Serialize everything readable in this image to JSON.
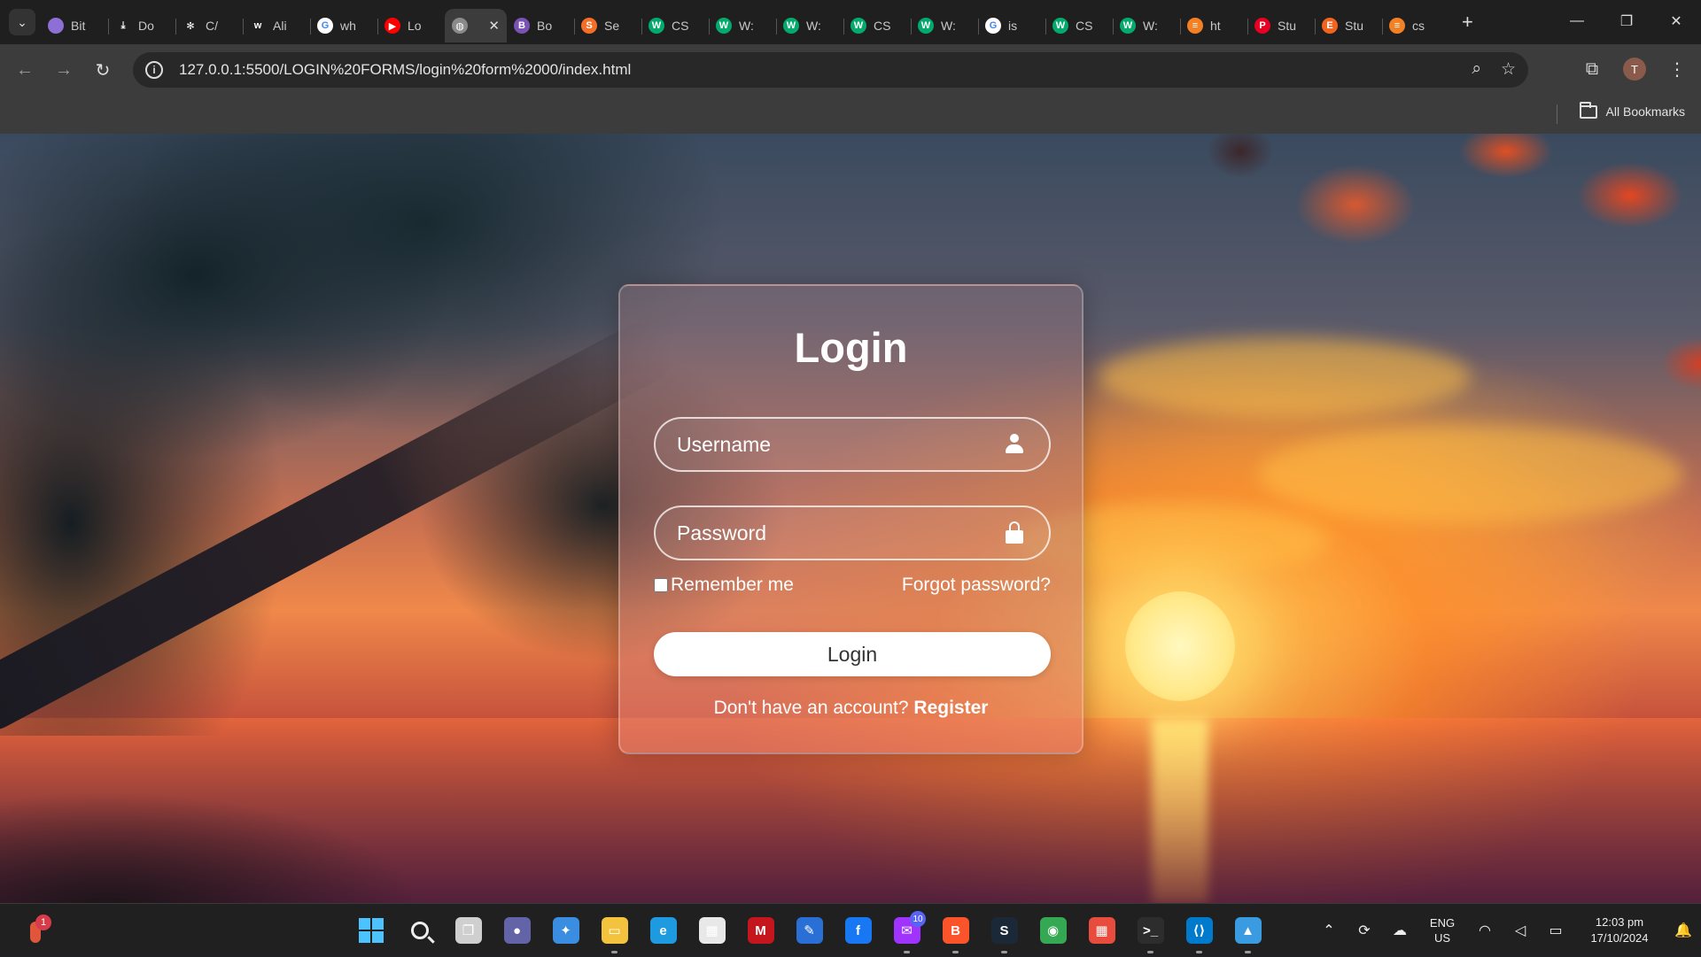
{
  "browser": {
    "url": "127.0.0.1:5500/LOGIN%20FORMS/login%20form%2000/index.html",
    "bookmarks_label": "All Bookmarks",
    "profile_initial": "T",
    "tabs": [
      {
        "title": "Bit",
        "icon": "globe-icon",
        "color": "#8e6fd6",
        "glyph": ""
      },
      {
        "title": "Do",
        "icon": "download-icon",
        "color": "#1f1f1f",
        "glyph": "⤓"
      },
      {
        "title": "C/",
        "icon": "openai-icon",
        "color": "#1f1f1f",
        "glyph": "✻"
      },
      {
        "title": "Ali",
        "icon": "w3-icon",
        "color": "#1f1f1f",
        "glyph": "w"
      },
      {
        "title": "wh",
        "icon": "google-icon",
        "color": "#ffffff",
        "glyph": "G"
      },
      {
        "title": "Lo",
        "icon": "youtube-icon",
        "color": "#ff0000",
        "glyph": "▶"
      },
      {
        "title": "",
        "icon": "globe-icon",
        "color": "#8a8a8a",
        "glyph": "◍"
      },
      {
        "title": "Bo",
        "icon": "bootstrap-icon",
        "color": "#7952b3",
        "glyph": "B"
      },
      {
        "title": "Se",
        "icon": "semrush-icon",
        "color": "#f56e28",
        "glyph": "S"
      },
      {
        "title": "CS",
        "icon": "w3schools-icon",
        "color": "#04aa6d",
        "glyph": "W"
      },
      {
        "title": "W:",
        "icon": "w3schools-icon",
        "color": "#04aa6d",
        "glyph": "W"
      },
      {
        "title": "W:",
        "icon": "w3schools-icon",
        "color": "#04aa6d",
        "glyph": "W"
      },
      {
        "title": "CS",
        "icon": "w3schools-icon",
        "color": "#04aa6d",
        "glyph": "W"
      },
      {
        "title": "W:",
        "icon": "w3schools-icon",
        "color": "#04aa6d",
        "glyph": "W"
      },
      {
        "title": "is",
        "icon": "google-icon",
        "color": "#ffffff",
        "glyph": "G"
      },
      {
        "title": "CS",
        "icon": "w3schools-icon",
        "color": "#04aa6d",
        "glyph": "W"
      },
      {
        "title": "W:",
        "icon": "w3schools-icon",
        "color": "#04aa6d",
        "glyph": "W"
      },
      {
        "title": "ht",
        "icon": "stackoverflow-icon",
        "color": "#f48024",
        "glyph": "≡"
      },
      {
        "title": "Stu",
        "icon": "pinterest-icon",
        "color": "#e60023",
        "glyph": "P"
      },
      {
        "title": "Stu",
        "icon": "etsy-icon",
        "color": "#f1641e",
        "glyph": "E"
      },
      {
        "title": "cs",
        "icon": "stackoverflow-icon",
        "color": "#f48024",
        "glyph": "≡"
      }
    ]
  },
  "login": {
    "title": "Login",
    "username_placeholder": "Username",
    "password_placeholder": "Password",
    "remember_label": "Remember me",
    "forgot_label": "Forgot password?",
    "button_label": "Login",
    "register_prompt": "Don't have an account?",
    "register_label": "Register"
  },
  "taskbar": {
    "widget_badge": "1",
    "messenger_badge": "10",
    "lang_line1": "ENG",
    "lang_line2": "US",
    "time": "12:03 pm",
    "date": "17/10/2024",
    "apps": [
      {
        "name": "start-button",
        "icon": "windows-icon",
        "color": "#4cc2ff",
        "glyph": "",
        "state": ""
      },
      {
        "name": "search-button",
        "icon": "search-icon",
        "color": "#202020",
        "glyph": "",
        "state": ""
      },
      {
        "name": "task-view-button",
        "icon": "task-view-icon",
        "color": "#cfcfcf",
        "glyph": "❐",
        "state": ""
      },
      {
        "name": "teams-app",
        "icon": "chat-icon",
        "color": "#6264a7",
        "glyph": "●",
        "state": ""
      },
      {
        "name": "copilot-app",
        "icon": "copilot-icon",
        "color": "#3a8de0",
        "glyph": "✦",
        "state": ""
      },
      {
        "name": "file-explorer-app",
        "icon": "folder-icon",
        "color": "#f3c33d",
        "glyph": "▭",
        "state": "open"
      },
      {
        "name": "edge-app",
        "icon": "edge-icon",
        "color": "#1e9be0",
        "glyph": "e",
        "state": ""
      },
      {
        "name": "store-app",
        "icon": "store-icon",
        "color": "#e8e8e8",
        "glyph": "▦",
        "state": ""
      },
      {
        "name": "mcafee-app",
        "icon": "shield-icon",
        "color": "#c4161c",
        "glyph": "M",
        "state": ""
      },
      {
        "name": "drawing-app",
        "icon": "pen-icon",
        "color": "#2a6fd6",
        "glyph": "✎",
        "state": ""
      },
      {
        "name": "facebook-app",
        "icon": "facebook-icon",
        "color": "#1877f2",
        "glyph": "f",
        "state": ""
      },
      {
        "name": "messenger-app",
        "icon": "messenger-icon",
        "color": "#a033ff",
        "glyph": "✉",
        "state": "open"
      },
      {
        "name": "brave-app",
        "icon": "brave-icon",
        "color": "#fb542b",
        "glyph": "B",
        "state": "open"
      },
      {
        "name": "steam-app",
        "icon": "steam-icon",
        "color": "#1b2838",
        "glyph": "S",
        "state": "open"
      },
      {
        "name": "chrome-app",
        "icon": "chrome-icon",
        "color": "#34a853",
        "glyph": "◉",
        "state": "active"
      },
      {
        "name": "apps-grid-app",
        "icon": "grid-icon",
        "color": "#e74c3c",
        "glyph": "▦",
        "state": ""
      },
      {
        "name": "terminal-app",
        "icon": "terminal-icon",
        "color": "#2d2d2d",
        "glyph": ">_",
        "state": "open"
      },
      {
        "name": "vscode-app",
        "icon": "vscode-icon",
        "color": "#007acc",
        "glyph": "⟨⟩",
        "state": "open"
      },
      {
        "name": "photos-app",
        "icon": "photos-icon",
        "color": "#3a9be0",
        "glyph": "▲",
        "state": "open"
      }
    ]
  }
}
